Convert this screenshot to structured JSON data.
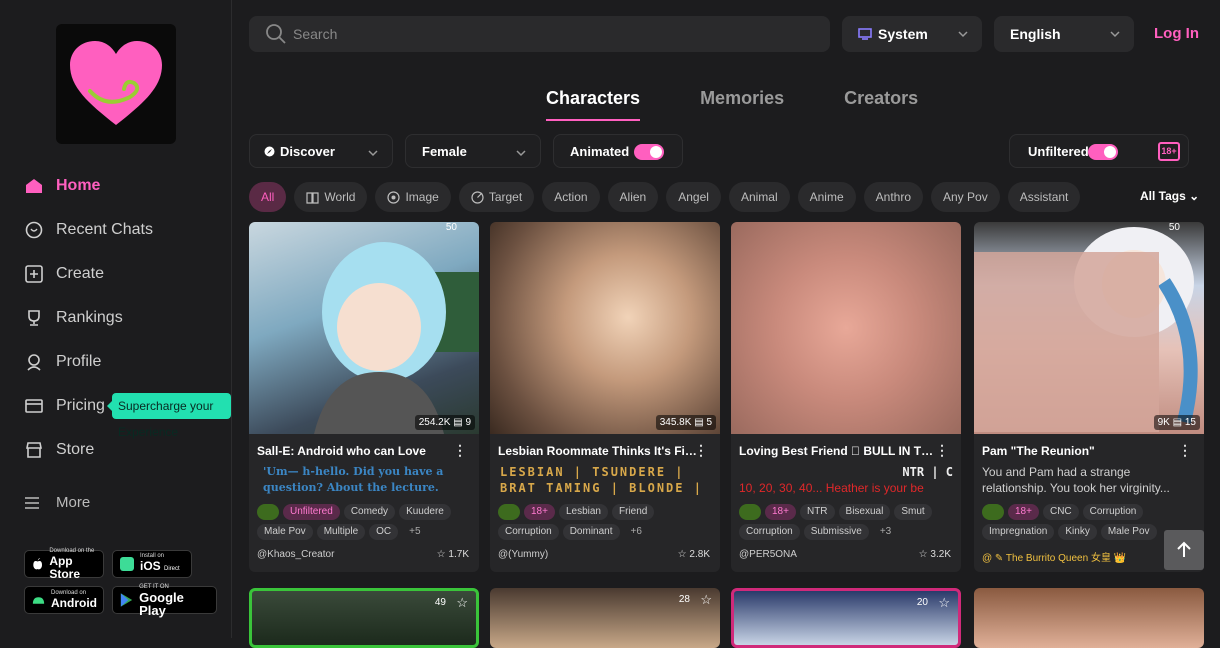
{
  "sidebar": {
    "nav": [
      {
        "label": "Home",
        "icon": "home-icon"
      },
      {
        "label": "Recent Chats",
        "icon": "chat-icon"
      },
      {
        "label": "Create",
        "icon": "plus-square-icon"
      },
      {
        "label": "Rankings",
        "icon": "trophy-icon"
      },
      {
        "label": "Profile",
        "icon": "user-icon"
      },
      {
        "label": "Pricing",
        "icon": "card-icon"
      },
      {
        "label": "Store",
        "icon": "store-icon"
      }
    ],
    "tooltip": "Supercharge your Experience",
    "more": "More",
    "stores": [
      {
        "small": "Download on the",
        "big": "App Store"
      },
      {
        "small": "Install on",
        "big": "iOS",
        "extra": "Direct"
      },
      {
        "small": "Download on",
        "big": "Android"
      },
      {
        "small": "GET IT ON",
        "big": "Google Play"
      }
    ]
  },
  "header": {
    "search_placeholder": "Search",
    "theme": "System",
    "language": "English",
    "login": "Log In"
  },
  "tabs": [
    "Characters",
    "Memories",
    "Creators"
  ],
  "filters": {
    "discover": "Discover",
    "gender": "Female",
    "animated": "Animated",
    "unfiltered": "Unfiltered",
    "age_badge": "18+"
  },
  "chips": [
    "All",
    "World",
    "Image",
    "Target",
    "Action",
    "Alien",
    "Angel",
    "Animal",
    "Anime",
    "Anthro",
    "Any Pov",
    "Assistant"
  ],
  "all_tags": "All Tags",
  "cards": [
    {
      "title": "Sall-E: Android who can Love",
      "desc": "'Um— h-hello. Did you have a question? About the lecture.",
      "tags": [
        "Unfiltered",
        "Comedy",
        "Kuudere",
        "Male Pov",
        "Multiple",
        "OC",
        "+5"
      ],
      "creator": "@Khaos_Creator",
      "likes": "1.7K",
      "stat1": "254.2K",
      "stat2": "9",
      "badge": "50"
    },
    {
      "title": "Lesbian Roommate Thinks It's Fin...",
      "desc": "LESBIAN | TSUNDERE | BRAT TAMING | BLONDE |",
      "tags": [
        "18+",
        "Lesbian",
        "Friend",
        "Corruption",
        "Dominant",
        "+6"
      ],
      "creator": "@(Yummy)",
      "likes": "2.8K",
      "stat1": "345.8K",
      "stat2": "5"
    },
    {
      "title": "Loving Best Friend 🏻 BULL IN THE...",
      "desc1": "NTR | C",
      "desc2": "10, 20, 30, 40... Heather is your be",
      "tags": [
        "18+",
        "NTR",
        "Bisexual",
        "Smut",
        "Corruption",
        "Submissive",
        "+3"
      ],
      "creator": "@PER5ONA",
      "likes": "3.2K"
    },
    {
      "title": "Pam \"The Reunion\"",
      "desc": "You and Pam had a strange relationship. You took her virginity...",
      "tags": [
        "18+",
        "CNC",
        "Corruption",
        "Impregnation",
        "Kinky",
        "Male Pov"
      ],
      "creator": "@ ✎ The Burrito Queen 女皇 👑",
      "likes": "",
      "stat1": "9K",
      "stat2": "15",
      "badge": "50"
    }
  ],
  "row2_badges": [
    "49",
    "28",
    "20"
  ],
  "colors": {
    "accent": "#ff5fbf",
    "tooltip": "#22e0b0",
    "bg": "#1c1c1e",
    "card": "#262628"
  }
}
